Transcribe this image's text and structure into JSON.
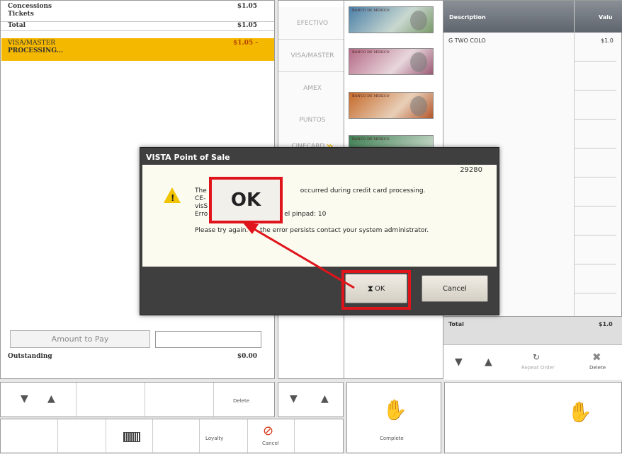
{
  "order": {
    "rows": [
      {
        "label": "Concessions",
        "value": "$1.05"
      },
      {
        "label": "Tickets",
        "value": ""
      },
      {
        "label": "Total",
        "value": "$1.05"
      }
    ],
    "payment": {
      "label": "VISA/MASTER",
      "value": "$1.05 -",
      "status": "PROCESSING..."
    },
    "amount_to_pay_label": "Amount to Pay",
    "amount_to_pay_value": "",
    "outstanding_label": "Outstanding",
    "outstanding_value": "$0.00"
  },
  "payment_methods": [
    "EFECTIVO",
    "VISA/MASTER",
    "AMEX",
    "PUNTOS",
    "CINECARD"
  ],
  "bills": [
    "BANCO DE MEXICO",
    "BANCO DE MEXICO",
    "BANCO DE MEXICO",
    "BANCO DE MEXICO"
  ],
  "items_table": {
    "headers": [
      "Description",
      "Valu"
    ],
    "rows": [
      {
        "desc": "G TWO COLO",
        "value": "$1.0"
      }
    ],
    "total_label": "Total",
    "total_value": "$1.0"
  },
  "right_actions": {
    "repeat_order": "Repeat Order",
    "delete": "Delete"
  },
  "bottom": {
    "delete": "Delete",
    "loyalty": "Loyalty",
    "cancel": "Cancel",
    "complete": "Complete"
  },
  "dialog": {
    "title": "VISTA Point of Sale",
    "code": "29280",
    "line1_start": "The",
    "line1_end": "occurred during credit card processing.",
    "line2": "CE-",
    "line3": "visS",
    "line4_start": "Erro",
    "line4_end": "el pinpad: 10",
    "line5_start": "Please try again. If",
    "line5_end": "the error persists contact your system administrator.",
    "ok_label": "OK",
    "cancel_label": "Cancel"
  },
  "callout": {
    "zoom_ok_label": "OK"
  },
  "colors": {
    "highlight": "#f5b800",
    "annotation_red": "#e0141b",
    "dialog_title_bg": "#3f3f3f"
  }
}
